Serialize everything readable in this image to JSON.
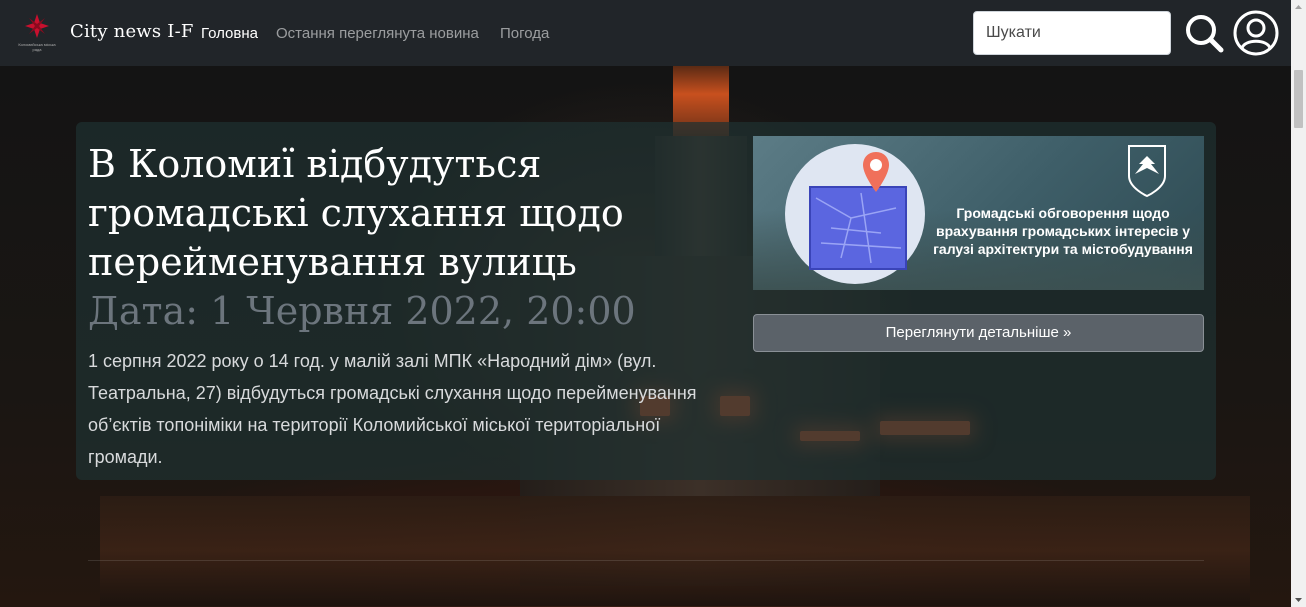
{
  "header": {
    "logo_text": "Коломийська міська рада",
    "brand": "City news I-F",
    "nav": [
      {
        "label": "Головна",
        "active": true
      },
      {
        "label": "Остання переглянута новина",
        "active": false
      },
      {
        "label": "Погода",
        "active": false
      }
    ],
    "search_placeholder": "Шукати",
    "search_icon": "search-icon",
    "account_icon": "user-circle-icon"
  },
  "article": {
    "title": "В Коломиї відбудуться громадські слухання щодо перейменування вулиць",
    "date": "Дата: 1 Червня 2022, 20:00",
    "description": "1 серпня 2022 року о 14 год. у малій залі МПК «Народний дім» (вул. Театральна, 27) відбудуться громадські слухання щодо перейменування об’єктів топоніміки на території Коломийської міської територіальної громади.",
    "image_caption": "Громадські обговорення щодо врахування громадських інтересів у галузі архітектури та містобудування",
    "detail_button": "Переглянути детальніше »"
  },
  "colors": {
    "navbar_bg": "#212529",
    "card_bg": "#1e3030",
    "date_color": "#6c757d",
    "button_bg": "#5b6269"
  }
}
